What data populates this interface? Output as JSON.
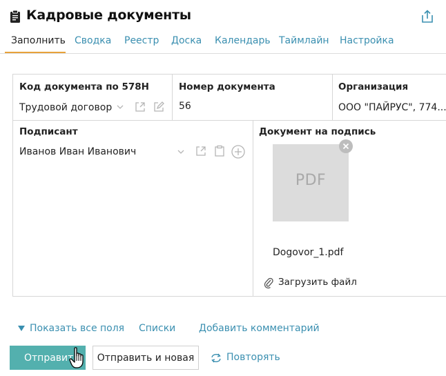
{
  "header": {
    "title": "Кадровые документы",
    "title_icon": "clipboard-icon",
    "share_icon": "share-icon"
  },
  "tabs": [
    {
      "label": "Заполнить",
      "active": true
    },
    {
      "label": "Сводка",
      "active": false
    },
    {
      "label": "Реестр",
      "active": false
    },
    {
      "label": "Доска",
      "active": false
    },
    {
      "label": "Календарь",
      "active": false
    },
    {
      "label": "Таймлайн",
      "active": false
    },
    {
      "label": "Настройка",
      "active": false
    }
  ],
  "form": {
    "doc_code": {
      "label": "Код документа по 578Н",
      "value": "Трудовой договор"
    },
    "doc_number": {
      "label": "Номер документа",
      "value": "56"
    },
    "organization": {
      "label": "Организация",
      "value": "ООО \"ПАЙРУС\", 774..."
    },
    "signer": {
      "label": "Подписант",
      "value": "Иванов Иван Иванович"
    },
    "document": {
      "label": "Документ на подпись",
      "thumb_text": "PDF",
      "file_name": "Dogovor_1.pdf",
      "upload_label": "Загрузить файл"
    }
  },
  "links": {
    "show_all": "Показать все поля",
    "lists": "Списки",
    "add_comment": "Добавить комментарий"
  },
  "actions": {
    "submit": "Отправить",
    "submit_new": "Отправить и новая",
    "repeat": "Повторять"
  },
  "colors": {
    "accent": "#3a8fb0",
    "button": "#53b0ae",
    "tab_underline": "#e8a23a"
  }
}
